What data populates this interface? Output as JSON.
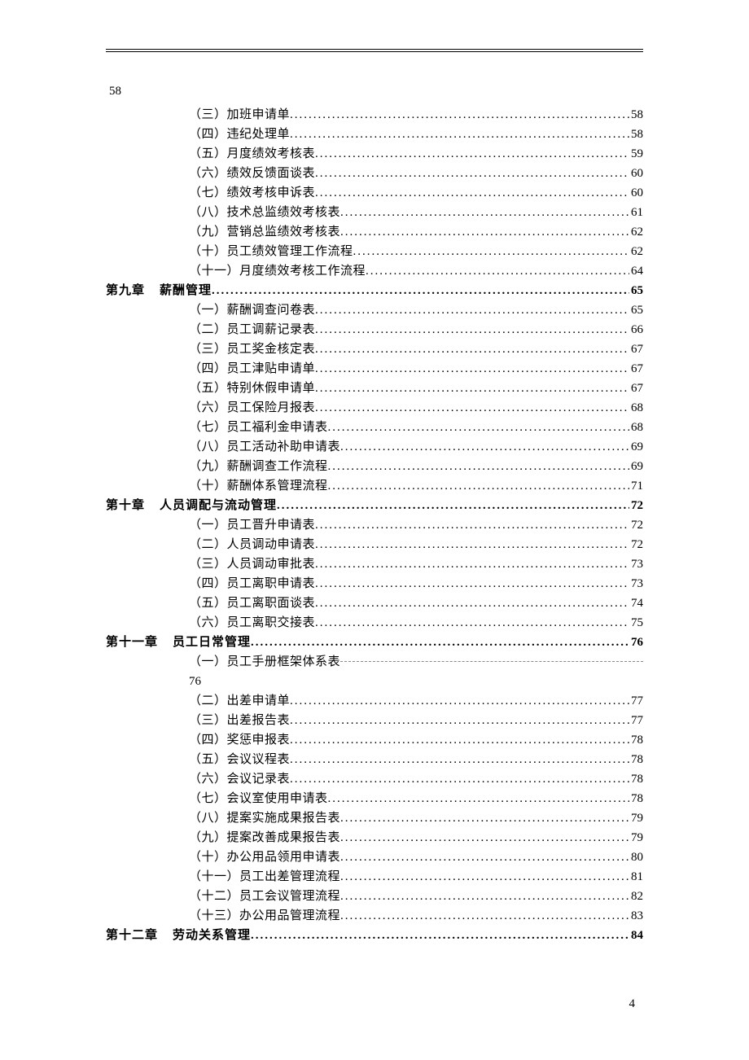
{
  "orphan_page_top": "58",
  "toc": [
    {
      "type": "sub",
      "label": "（三）加班申请单",
      "page": "58"
    },
    {
      "type": "sub",
      "label": "（四）违纪处理单",
      "page": "58"
    },
    {
      "type": "sub",
      "label": "（五）月度绩效考核表",
      "page": "59"
    },
    {
      "type": "sub",
      "label": "（六）绩效反馈面谈表",
      "page": "60"
    },
    {
      "type": "sub",
      "label": "（七）绩效考核申诉表",
      "page": "60"
    },
    {
      "type": "sub",
      "label": "（八）技术总监绩效考核表",
      "page": "61"
    },
    {
      "type": "sub",
      "label": "（九）营销总监绩效考核表",
      "page": "62"
    },
    {
      "type": "sub",
      "label": "（十）员工绩效管理工作流程",
      "page": "62"
    },
    {
      "type": "sub",
      "label": "（十一）月度绩效考核工作流程",
      "page": "64"
    },
    {
      "type": "chapter",
      "chapter": "第九章",
      "title": "薪酬管理",
      "page": "65"
    },
    {
      "type": "sub",
      "label": "（一）薪酬调查问卷表",
      "page": "65"
    },
    {
      "type": "sub",
      "label": "（二）员工调薪记录表",
      "page": "66"
    },
    {
      "type": "sub",
      "label": "（三）员工奖金核定表",
      "page": "67"
    },
    {
      "type": "sub",
      "label": "（四）员工津贴申请单",
      "page": "67"
    },
    {
      "type": "sub",
      "label": "（五）特别休假申请单",
      "page": "67"
    },
    {
      "type": "sub",
      "label": "（六）员工保险月报表",
      "page": "68"
    },
    {
      "type": "sub",
      "label": "（七）员工福利金申请表",
      "page": "68"
    },
    {
      "type": "sub",
      "label": "（八）员工活动补助申请表",
      "page": "69"
    },
    {
      "type": "sub",
      "label": "（九）薪酬调查工作流程",
      "page": "69"
    },
    {
      "type": "sub",
      "label": "（十）薪酬体系管理流程",
      "page": "71"
    },
    {
      "type": "chapter",
      "chapter": "第十章",
      "title": "人员调配与流动管理",
      "page": "72"
    },
    {
      "type": "sub",
      "label": "（一）员工晋升申请表",
      "page": "72"
    },
    {
      "type": "sub",
      "label": "（二）人员调动申请表",
      "page": "72"
    },
    {
      "type": "sub",
      "label": "（三）人员调动审批表",
      "page": "73"
    },
    {
      "type": "sub",
      "label": "（四）员工离职申请表",
      "page": "73"
    },
    {
      "type": "sub",
      "label": "（五）员工离职面谈表",
      "page": "74"
    },
    {
      "type": "sub",
      "label": "（六）员工离职交接表",
      "page": "75"
    },
    {
      "type": "chapter",
      "chapter": "第十一章",
      "title": "员工日常管理",
      "page": "76"
    },
    {
      "type": "sub-dash",
      "label": "（一）员工手册框架体系表",
      "wrap_page": "76"
    },
    {
      "type": "sub",
      "label": "（二）出差申请单",
      "page": "77"
    },
    {
      "type": "sub",
      "label": "（三）出差报告表",
      "page": "77"
    },
    {
      "type": "sub",
      "label": "（四）奖惩申报表",
      "page": "78"
    },
    {
      "type": "sub",
      "label": "（五）会议议程表",
      "page": "78"
    },
    {
      "type": "sub",
      "label": "（六）会议记录表",
      "page": "78"
    },
    {
      "type": "sub",
      "label": "（七）会议室使用申请表",
      "page": "78"
    },
    {
      "type": "sub",
      "label": "（八）提案实施成果报告表",
      "page": "79"
    },
    {
      "type": "sub",
      "label": "（九）提案改善成果报告表",
      "page": "79"
    },
    {
      "type": "sub",
      "label": "（十）办公用品领用申请表",
      "page": "80"
    },
    {
      "type": "sub",
      "label": "（十一）员工出差管理流程",
      "page": "81"
    },
    {
      "type": "sub",
      "label": "（十二）员工会议管理流程",
      "page": "82"
    },
    {
      "type": "sub",
      "label": "（十三）办公用品管理流程",
      "page": "83"
    },
    {
      "type": "chapter",
      "chapter": "第十二章",
      "title": "劳动关系管理",
      "page": "84"
    }
  ],
  "footer_page": "4"
}
